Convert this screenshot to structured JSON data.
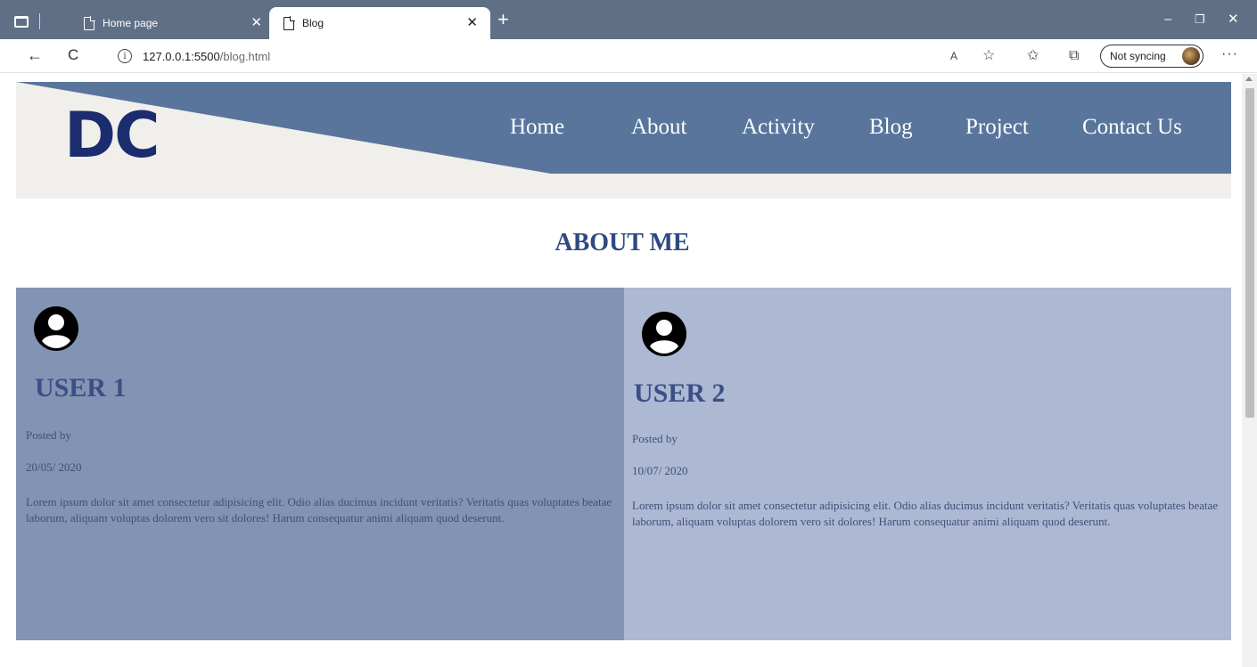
{
  "browser": {
    "tabs": [
      {
        "title": "Home page",
        "active": false
      },
      {
        "title": "Blog",
        "active": true
      }
    ],
    "url_host": "127.0.0.1:5500",
    "url_path": "/blog.html",
    "sync_label": "Not syncing",
    "icons": {
      "back": "←",
      "reload": "C",
      "info": "i",
      "read_aloud": "A",
      "favorite": "☆",
      "favorites": "✩",
      "collections": "⧉",
      "more": "···",
      "new_tab": "+",
      "close": "✕",
      "minimize": "–",
      "restore": "❐",
      "window_close": "✕"
    }
  },
  "site": {
    "logo": "DC",
    "nav": [
      "Home",
      "About",
      "Activity",
      "Blog",
      "Project",
      "Contact Us"
    ],
    "colors": {
      "header_band": "#59759c",
      "header_bg": "#f1efeb",
      "logo": "#1b2d6e",
      "title": "#2e4a80",
      "card1": "#8393b4",
      "card2": "#adb8d3"
    },
    "title": "ABOUT ME",
    "posts": [
      {
        "user": "USER 1",
        "posted_by": "Posted by",
        "date": "20/05/ 2020",
        "body": "Lorem ipsum dolor sit amet consectetur adipisicing elit. Odio alias ducimus incidunt veritatis? Veritatis quas voluptates beatae laborum, aliquam voluptas dolorem vero sit dolores! Harum consequatur animi aliquam quod deserunt."
      },
      {
        "user": "USER 2",
        "posted_by": "Posted by",
        "date": "10/07/ 2020",
        "body": "Lorem ipsum dolor sit amet consectetur adipisicing elit. Odio alias ducimus incidunt veritatis? Veritatis quas voluptates beatae laborum, aliquam voluptas dolorem vero sit dolores! Harum consequatur animi aliquam quod deserunt."
      }
    ]
  }
}
